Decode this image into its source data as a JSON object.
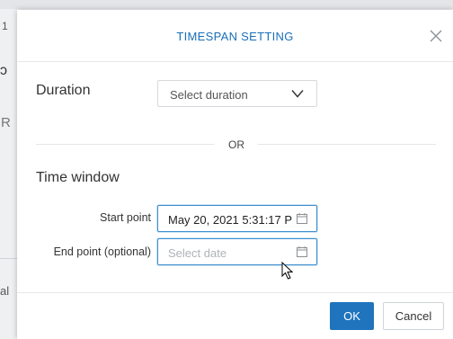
{
  "background": {
    "fragments": [
      "1",
      "ɔ",
      "R",
      "al"
    ]
  },
  "dialog": {
    "title": "TIMESPAN SETTING",
    "close_icon": "close-icon"
  },
  "duration": {
    "label": "Duration",
    "placeholder": "Select duration",
    "chevron_icon": "chevron-down-icon"
  },
  "separator": {
    "label": "OR"
  },
  "time_window": {
    "label": "Time window",
    "start_point": {
      "label": "Start point",
      "value": "May 20, 2021 5:31:17 P",
      "icon": "calendar-icon"
    },
    "end_point": {
      "label": "End point (optional)",
      "placeholder": "Select date",
      "icon": "calendar-icon"
    }
  },
  "footer": {
    "ok_label": "OK",
    "cancel_label": "Cancel"
  },
  "colors": {
    "accent": "#1f74bd",
    "title": "#1a6fb8",
    "focus_border": "#3d8fd0"
  }
}
